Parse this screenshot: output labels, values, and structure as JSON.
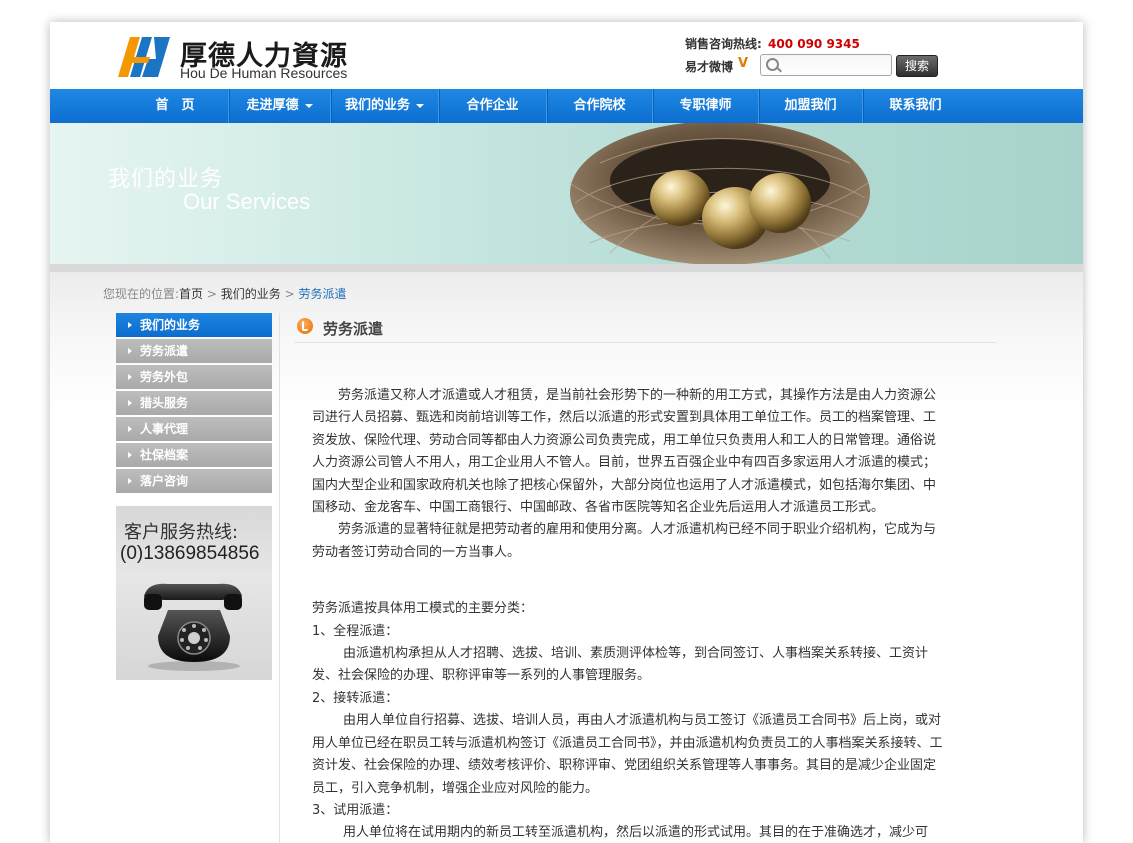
{
  "header": {
    "logo_cn": "厚德人力資源",
    "logo_en": "Hou De Human Resources",
    "hotline_label": "销售咨询热线:",
    "hotline_number": "400 090 9345",
    "weibo_label": "易才微博",
    "weibo_v": "V",
    "search_placeholder": "",
    "search_button": "搜索"
  },
  "nav": {
    "items": [
      {
        "label": "首　页"
      },
      {
        "label": "走进厚德"
      },
      {
        "label": "我们的业务"
      },
      {
        "label": "合作企业"
      },
      {
        "label": "合作院校"
      },
      {
        "label": "专职律师"
      },
      {
        "label": "加盟我们"
      },
      {
        "label": "联系我们"
      }
    ]
  },
  "banner": {
    "title_cn": "我们的业务",
    "title_en": "Our Services"
  },
  "breadcrumb": {
    "prefix": "您现在的位置:",
    "home": "首页",
    "sep1": " > ",
    "section": "我们的业务",
    "sep2": " > ",
    "current": "劳务派遣"
  },
  "sidebar": {
    "items": [
      {
        "label": "我们的业务"
      },
      {
        "label": "劳务派遣"
      },
      {
        "label": "劳务外包"
      },
      {
        "label": "猎头服务"
      },
      {
        "label": "人事代理"
      },
      {
        "label": "社保档案"
      },
      {
        "label": "落户咨询"
      }
    ],
    "service_label": "客户服务热线:",
    "service_number": "(0)13869854856"
  },
  "content": {
    "title": "劳务派遣",
    "p1": "劳务派遣又称人才派遣或人才租赁，是当前社会形势下的一种新的用工方式，其操作方法是由人力资源公司进行人员招募、甄选和岗前培训等工作，然后以派遣的形式安置到具体用工单位工作。员工的档案管理、工资发放、保险代理、劳动合同等都由人力资源公司负责完成，用工单位只负责用人和工人的日常管理。通俗说人力资源公司管人不用人，用工企业用人不管人。目前，世界五百强企业中有四百多家运用人才派遣的模式；国内大型企业和国家政府机关也除了把核心保留外，大部分岗位也运用了人才派遣模式，如包括海尔集团、中国移动、金龙客车、中国工商银行、中国邮政、各省市医院等知名企业先后运用人才派遣员工形式。",
    "p2": "劳务派遣的显著特征就是把劳动者的雇用和使用分离。人才派遣机构已经不同于职业介绍机构，它成为与劳动者签订劳动合同的一方当事人。",
    "p3": "劳务派遣按具体用工模式的主要分类：",
    "h1": "1、全程派遣：",
    "p4": "由派遣机构承担从人才招聘、选拔、培训、素质测评体检等，到合同签订、人事档案关系转接、工资计发、社会保险的办理、职称评审等一系列的人事管理服务。",
    "h2": "2、接转派遣：",
    "p5": "由用人单位自行招募、选拔、培训人员，再由人才派遣机构与员工签订《派遣员工合同书》后上岗，或对用人单位已经在职员工转与派遣机构签订《派遣员工合同书》，并由派遣机构负责员工的人事档案关系接转、工资计发、社会保险的办理、绩效考核评价、职称评审、党团组织关系管理等人事事务。其目的是减少企业固定员工，引入竞争机制，增强企业应对风险的能力。",
    "h3": "3、试用派遣：",
    "p6": "用人单位将在试用期内的新员工转至派遣机构，然后以派遣的形式试用。其目的在于准确选才，减少可"
  },
  "colors": {
    "nav_blue": "#1a7ed9",
    "hotline_red": "#cc0000",
    "link_blue": "#1e6fb8",
    "sidebar_gray": "#b3b3b3"
  }
}
